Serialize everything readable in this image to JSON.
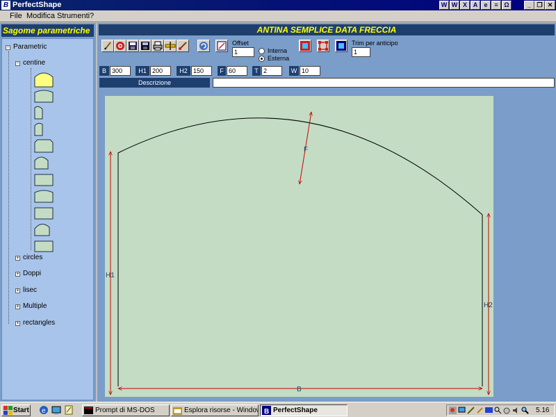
{
  "window": {
    "title": "PerfectShape",
    "office_bar": [
      "W",
      "X",
      "A",
      "e",
      "≡",
      "Ω"
    ],
    "controls": {
      "minimize": "_",
      "restore": "❐",
      "close": "✕"
    }
  },
  "menu": {
    "file": "File",
    "edit": "Modifica",
    "tools": "Strumenti",
    "help": "?"
  },
  "sidebar": {
    "title": "Sagome parametriche",
    "root": "Parametric",
    "centine": "centine",
    "groups": [
      "circles",
      "Doppi",
      "lisec",
      "Multiple",
      "rectangles"
    ],
    "expand_minus": "−",
    "expand_plus": "+"
  },
  "main": {
    "title": "ANTINA SEMPLICE DATA FRECCIA",
    "toolbar": [
      "pencil-icon",
      "target-icon",
      "save-icon",
      "save-as-icon",
      "print-icon",
      "ruler-icon",
      "brush-icon"
    ],
    "offset_label": "Offset",
    "offset_value": "1",
    "radio_interna": "Interna",
    "radio_esterna": "Esterna",
    "trim_label": "Trim per anticipo",
    "trim_value": "1",
    "params": {
      "B": {
        "label": "B",
        "value": "300"
      },
      "H1": {
        "label": "H1",
        "value": "200"
      },
      "H2": {
        "label": "H2",
        "value": "150"
      },
      "F": {
        "label": "F",
        "value": "60"
      },
      "T": {
        "label": "T",
        "value": "2"
      },
      "W": {
        "label": "W",
        "value": "10"
      }
    },
    "description_label": "Descrizione",
    "description_value": ""
  },
  "drawing": {
    "dim_labels": {
      "F": "F",
      "H1": "H1",
      "H2": "H2",
      "B": "B"
    },
    "colors": {
      "fill": "#c4dcc4",
      "outline": "#000000",
      "dimension": "#cc0000"
    }
  },
  "taskbar": {
    "start": "Start",
    "tasks": [
      "Prompt di MS-DOS",
      "Esplora risorse - Windows",
      "PerfectShape"
    ],
    "clock": "5.16"
  },
  "colors": {
    "title_bar": "#000080",
    "panel": "#7a9dc9",
    "header": "#1e3f6e",
    "header_text": "#ffff00"
  }
}
